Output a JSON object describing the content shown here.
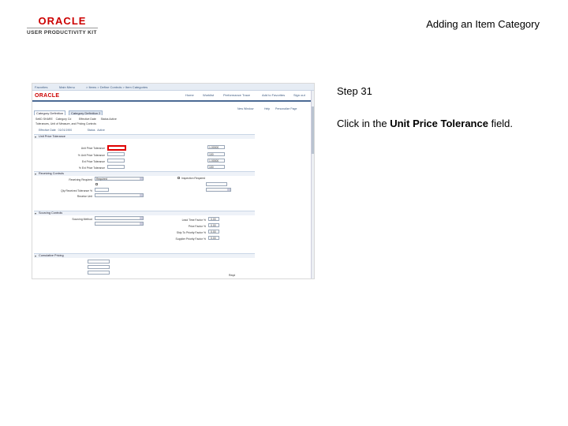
{
  "slide": {
    "logo_primary": "ORACLE",
    "logo_secondary": "USER PRODUCTIVITY KIT",
    "title": "Adding an Item Category",
    "step_title": "Step 31",
    "instruction_pre": "Click in the ",
    "instruction_bold": "Unit Price Tolerance",
    "instruction_post": " field."
  },
  "colors": {
    "logo_red": "#cc0000",
    "highlight_red": "#e00000",
    "nav_blue": "#3d5a80"
  },
  "screenshot": {
    "header": {
      "logo": "ORACLE",
      "links": [
        "Home",
        "Worklist",
        "Performance Trace",
        "Add to Favorites",
        "Sign out"
      ]
    },
    "tabs": [
      "Category Definition",
      "Category Definition 2"
    ],
    "toolbar_links": [
      "New Window",
      "Help",
      "Personalize Page"
    ],
    "sections": [
      "Unit Price Tolerance",
      "Receiving Controls",
      "Sourcing Controls",
      "Cumulative Pricing"
    ],
    "fields": {
      "unit_price_tolerance_label": "Unit Price Tolerance",
      "pct_unit_price_tolerance_label": "% Unit Price Tolerance",
      "ext_price_tolerance_label": "Ext Price Tolerance",
      "pct_ext_price_tolerance_label": "% Ext Price Tolerance",
      "receiving_required_label": "Receiving Required",
      "receiving_required_value": "Required",
      "qty_received_tol_label": "Qty Received Tolerance %",
      "receive_unit_label": "Receive Unit",
      "inspection_required_label": "Inspection Required",
      "sourcing_method_label": "Sourcing Method",
      "lead_time_factor_label": "Lead Time Factor %",
      "price_factor_label": "Price Factor %",
      "ship_to_priority_label": "Ship To Priority Factor %",
      "supplier_priority_label": "Supplier Priority Factor %",
      "zero_value": "0.00",
      "hundred_value": "100",
      "max_value": "1.00000",
      "reqd_value": "Reqd"
    }
  }
}
